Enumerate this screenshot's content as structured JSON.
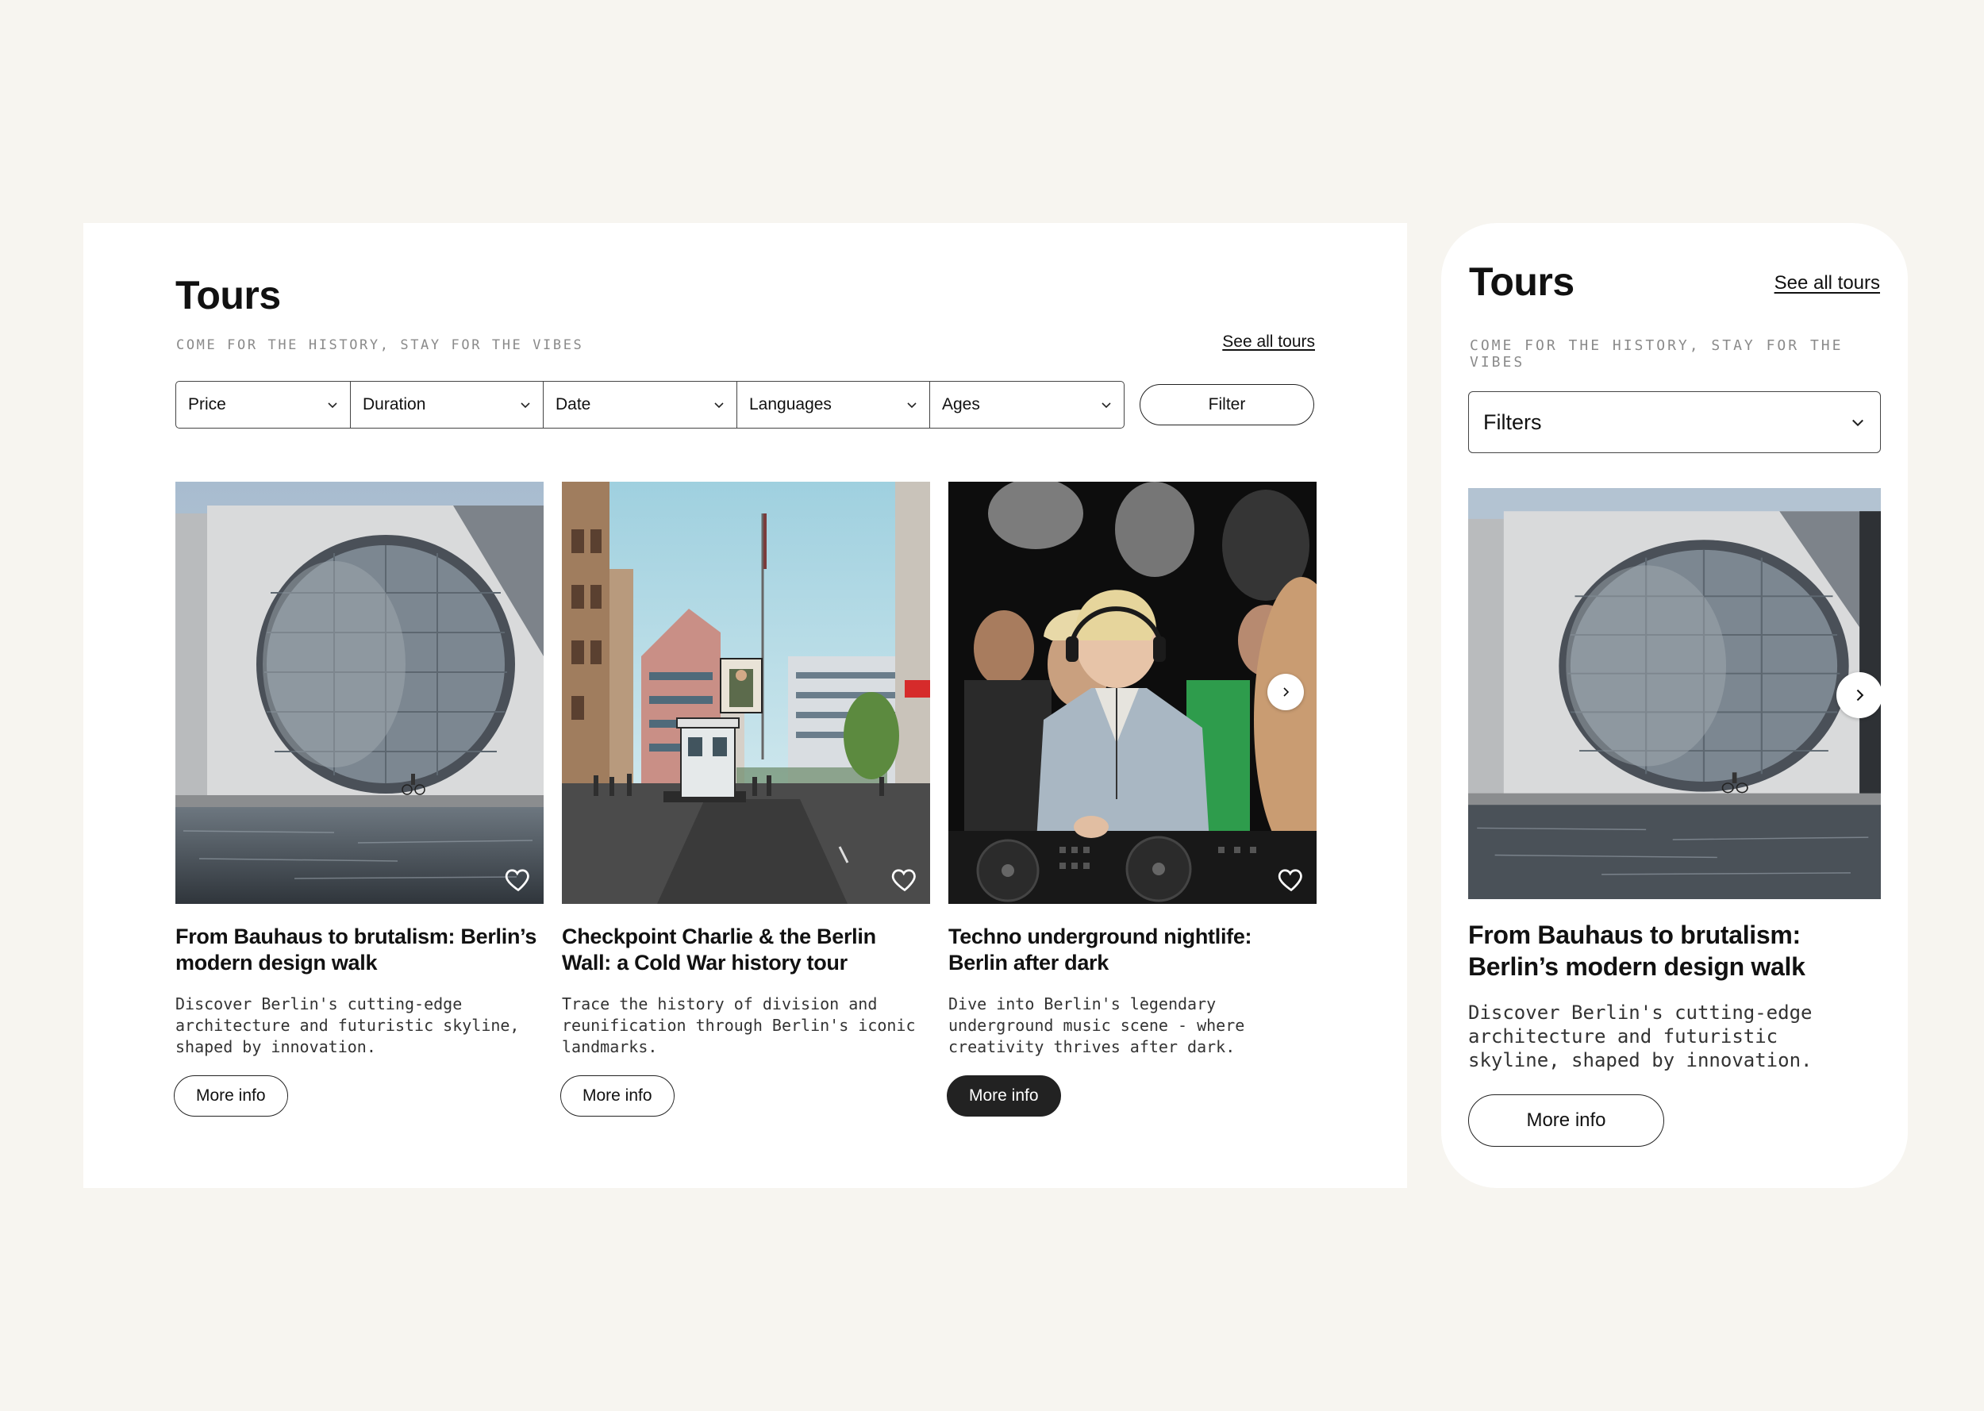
{
  "colors": {
    "page_bg": "#f7f5f0",
    "panel_bg": "#ffffff",
    "text": "#111111",
    "muted": "#8a8a8a",
    "dark_button": "#222222"
  },
  "desktop": {
    "title": "Tours",
    "tagline": "COME FOR THE HISTORY, STAY FOR THE VIBES",
    "see_all": "See all tours",
    "filters": [
      "Price",
      "Duration",
      "Date",
      "Languages",
      "Ages"
    ],
    "filter_button": "Filter",
    "cards": [
      {
        "title": "From Bauhaus to brutalism: Berlin’s modern design walk",
        "description": "Discover Berlin's cutting-edge architecture and futuristic skyline, shaped by innovation.",
        "button": "More info",
        "button_active": false,
        "favorite": false
      },
      {
        "title": "Checkpoint Charlie & the Berlin Wall: a Cold War history tour",
        "description": "Trace the history of division and reunification through Berlin's iconic landmarks.",
        "button": "More info",
        "button_active": false,
        "favorite": false
      },
      {
        "title": "Techno underground nightlife: Berlin after dark",
        "description": "Dive into Berlin's legendary underground music scene - where creativity thrives after dark.",
        "button": "More info",
        "button_active": true,
        "favorite": false
      }
    ],
    "icons": {
      "favorite": "heart-outline-icon",
      "next": "chevron-right-icon",
      "dropdown": "chevron-down-icon"
    }
  },
  "mobile": {
    "title": "Tours",
    "see_all": "See all tours",
    "tagline": "COME FOR THE HISTORY, STAY FOR THE VIBES",
    "filters_label": "Filters",
    "card": {
      "title": "From Bauhaus to brutalism: Berlin’s modern design walk",
      "description": "Discover Berlin's cutting-edge architecture and futuristic skyline, shaped by innovation.",
      "button": "More info"
    }
  }
}
